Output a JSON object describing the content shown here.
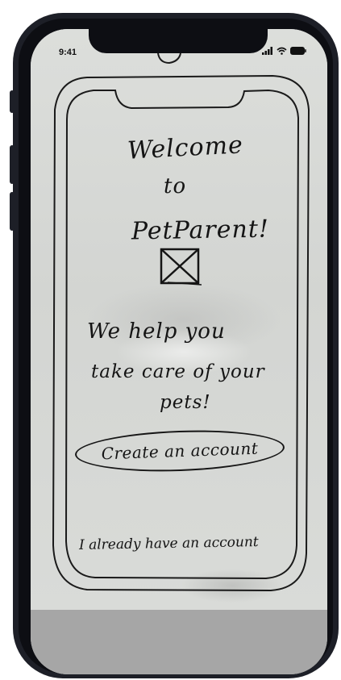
{
  "status_bar": {
    "time": "9:41",
    "icons": [
      "cellular-signal-icon",
      "wifi-icon",
      "battery-icon"
    ]
  },
  "sketch": {
    "welcome_line1": "Welcome",
    "welcome_line2": "to",
    "app_name": "PetParent!",
    "image_placeholder": "image-placeholder-icon",
    "tagline_line1": "We help you",
    "tagline_line2": "take care of your",
    "tagline_line3": "pets!",
    "create_account_label": "Create an account",
    "existing_account_label": "I already have an account"
  },
  "colors": {
    "phone_frame": "#1d1f27",
    "paper": "#d9dad6",
    "ink": "#141414",
    "bottom_panel": "#a6a6a6"
  }
}
